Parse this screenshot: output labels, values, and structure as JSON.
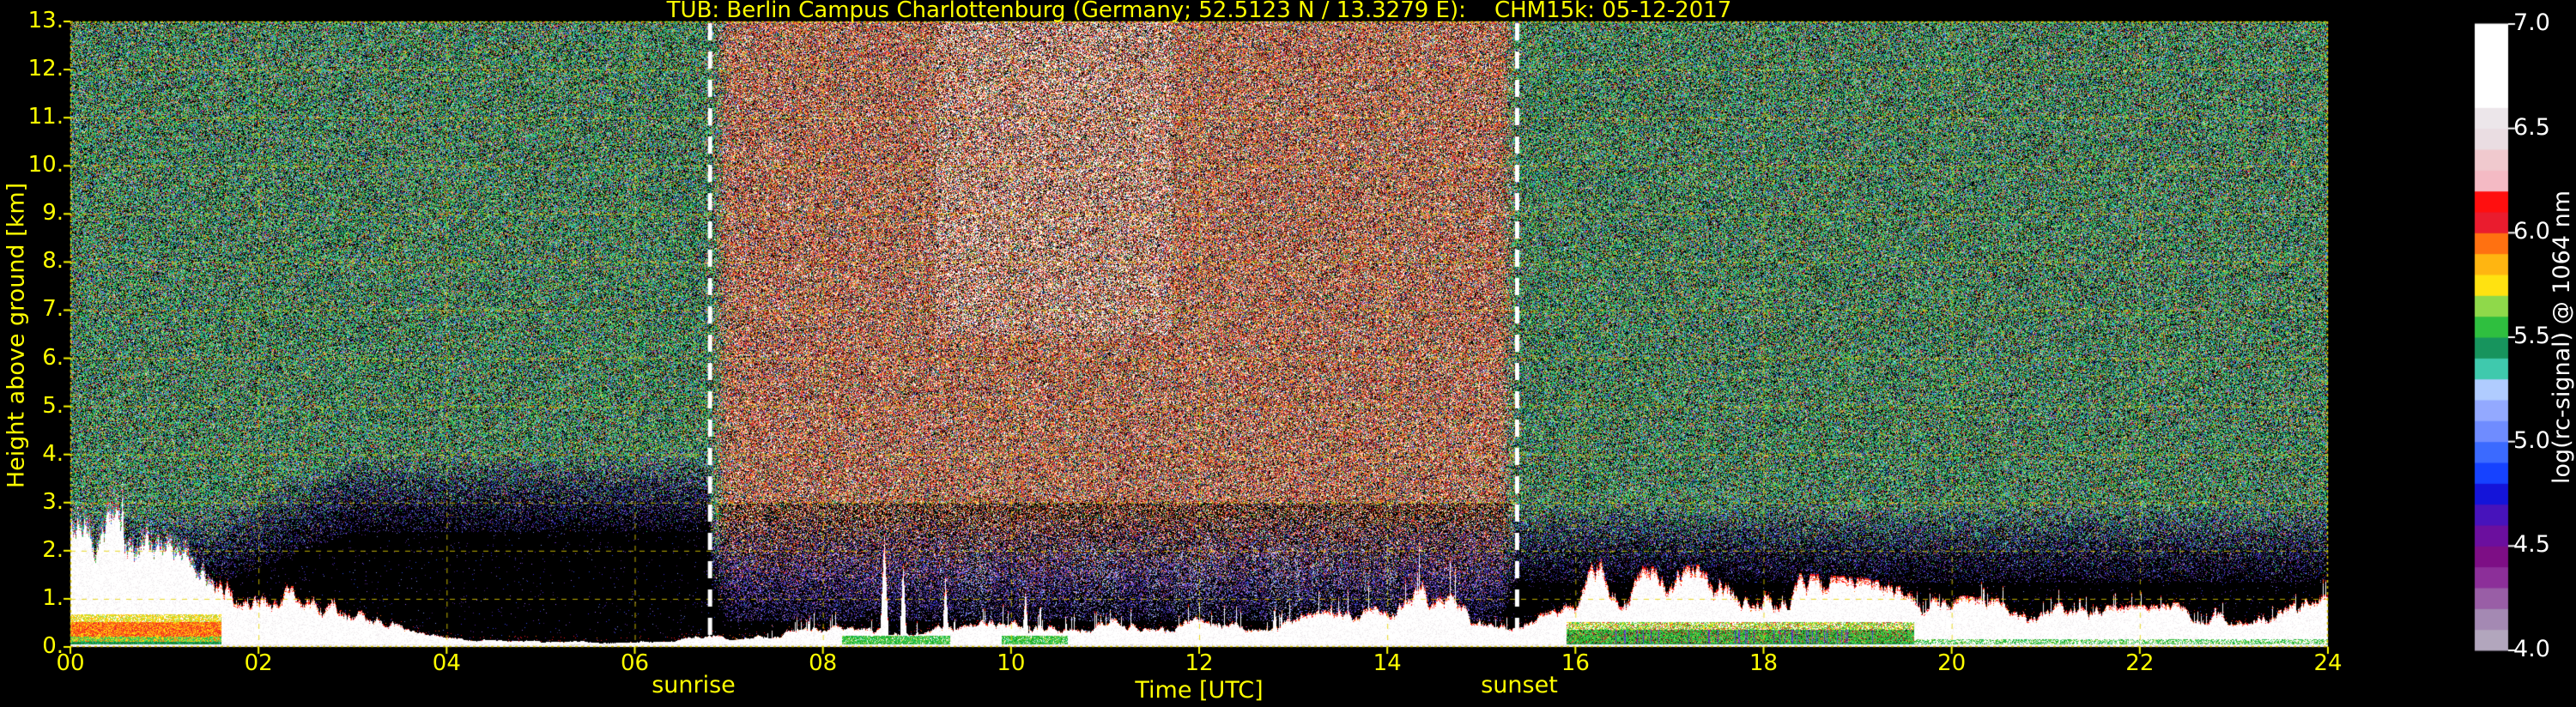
{
  "title": "TUB: Berlin Campus Charlottenburg (Germany; 52.5123 N / 13.3279 E):    CHM15k: 05-12-2017",
  "station": "TUB: Berlin Campus Charlottenburg",
  "country": "Germany",
  "coordinates": "52.5123 N / 13.3279 E",
  "instrument": "CHM15k",
  "date": "05-12-2017",
  "chart_data": {
    "type": "heatmap",
    "title": "TUB: Berlin Campus Charlottenburg (Germany; 52.5123 N / 13.3279 E):    CHM15k: 05-12-2017",
    "xlabel": "Time [UTC]",
    "ylabel": "Height above ground [km]",
    "xlim": [
      0,
      24
    ],
    "ylim": [
      0,
      13
    ],
    "grid": "yellow dashed, 2 h vertical / 1 km horizontal",
    "xticks": {
      "values": [
        0,
        2,
        4,
        6,
        8,
        10,
        12,
        14,
        16,
        18,
        20,
        22,
        24
      ],
      "labels": [
        "00",
        "02",
        "04",
        "06",
        "08",
        "10",
        "12",
        "14",
        "16",
        "18",
        "20",
        "22",
        "24"
      ]
    },
    "yticks": {
      "values": [
        0,
        1,
        2,
        3,
        4,
        5,
        6,
        7,
        8,
        9,
        10,
        11,
        12,
        13
      ],
      "labels": [
        "0.",
        "1.",
        "2.",
        "3.",
        "4.",
        "5.",
        "6.",
        "7.",
        "8.",
        "9.",
        "10.",
        "11.",
        "12.",
        "13."
      ]
    },
    "annotations": {
      "sunrise": {
        "label": "sunrise",
        "time_utc": 6.8
      },
      "sunset": {
        "label": "sunset",
        "time_utc": 15.38
      }
    },
    "colorbar": {
      "label": "log(rc-signal) @ 1064 nm",
      "range": [
        4.0,
        7.0
      ],
      "ticks": {
        "values": [
          4.0,
          4.5,
          5.0,
          5.5,
          6.0,
          6.5,
          7.0
        ],
        "labels": [
          "4.0",
          "4.5",
          "5.0",
          "5.5",
          "6.0",
          "6.5",
          "7.0"
        ]
      },
      "colors_bottom_to_top": [
        "#b2a6bd",
        "#a489b3",
        "#995ea6",
        "#8c2f99",
        "#7d0e85",
        "#6b0f9e",
        "#4713bb",
        "#1414d9",
        "#1642ff",
        "#3b6aff",
        "#6f8cff",
        "#93a9ff",
        "#b0ccff",
        "#3fc9ad",
        "#17945d",
        "#2fbf3f",
        "#8fd94a",
        "#ffe211",
        "#ffb511",
        "#ff7111",
        "#ea1c2e",
        "#ff0f0f",
        "#f4bac4",
        "#f0c9ce",
        "#eadde2",
        "#ece6ea",
        "#ffffff",
        "#ffffff",
        "#ffffff",
        "#ffffff"
      ]
    },
    "signal": {
      "description": "Ceilometer attenuated-backscatter quicklook: strong white/rainbow boundary-layer signal below ~1-3 km, colorful background noise aloft (green/blue at night, red/white during daylight between sunrise and sunset dashed lines).",
      "boundary_layer_top_km": [
        [
          0,
          2.7
        ],
        [
          0.3,
          2.5
        ],
        [
          0.6,
          2.1
        ],
        [
          0.9,
          1.75
        ],
        [
          1.2,
          1.55
        ],
        [
          1.6,
          1.35
        ],
        [
          2.0,
          1.05
        ],
        [
          2.4,
          0.85
        ],
        [
          2.8,
          0.9
        ],
        [
          3.2,
          0.55
        ],
        [
          3.6,
          0.25
        ],
        [
          4.0,
          0.14
        ],
        [
          4.5,
          0.1
        ],
        [
          5.0,
          0.1
        ],
        [
          5.5,
          0.1
        ],
        [
          6.0,
          0.12
        ],
        [
          6.5,
          0.16
        ],
        [
          7.0,
          0.2
        ],
        [
          7.5,
          0.26
        ],
        [
          8.0,
          0.3
        ],
        [
          8.5,
          0.32
        ],
        [
          9.0,
          0.36
        ],
        [
          9.5,
          0.38
        ],
        [
          10,
          0.4
        ],
        [
          10.5,
          0.42
        ],
        [
          11,
          0.42
        ],
        [
          11.5,
          0.44
        ],
        [
          12,
          0.44
        ],
        [
          12.5,
          0.46
        ],
        [
          13,
          0.5
        ],
        [
          13.5,
          0.55
        ],
        [
          14,
          0.6
        ],
        [
          14.35,
          1.0
        ],
        [
          14.7,
          0.75
        ],
        [
          15.1,
          0.6
        ],
        [
          15.38,
          0.45
        ],
        [
          15.7,
          0.5
        ],
        [
          16.0,
          0.7
        ],
        [
          16.2,
          1.3
        ],
        [
          16.5,
          1.15
        ],
        [
          17,
          1.15
        ],
        [
          17.5,
          1.2
        ],
        [
          18,
          1.1
        ],
        [
          18.5,
          1.05
        ],
        [
          19,
          1.0
        ],
        [
          19.5,
          0.9
        ],
        [
          20,
          0.75
        ],
        [
          20.5,
          0.7
        ],
        [
          21,
          0.65
        ],
        [
          21.5,
          0.6
        ],
        [
          22,
          0.6
        ],
        [
          22.5,
          0.65
        ],
        [
          23,
          0.65
        ],
        [
          23.5,
          0.7
        ],
        [
          24,
          0.75
        ]
      ],
      "spikes": [
        [
          0.15,
          3.0,
          0.06
        ],
        [
          0.55,
          3.6,
          0.05
        ],
        [
          8.65,
          2.4,
          0.05
        ],
        [
          8.85,
          1.8,
          0.04
        ],
        [
          9.3,
          1.5,
          0.04
        ],
        [
          10.15,
          1.2,
          0.04
        ],
        [
          12.8,
          0.9,
          0.04
        ],
        [
          13.4,
          0.95,
          0.05
        ],
        [
          14.35,
          1.12,
          0.18
        ],
        [
          16.2,
          1.45,
          0.12
        ],
        [
          19.8,
          1.05,
          0.05
        ],
        [
          20.1,
          1.1,
          0.06
        ],
        [
          21.3,
          0.95,
          0.05
        ],
        [
          22.8,
          0.9,
          0.05
        ]
      ]
    },
    "noise": {
      "night_high": [
        [
          "#2fbf55",
          18
        ],
        [
          "#29c98c",
          12
        ],
        [
          "#63d955",
          8
        ],
        [
          "#15913a",
          8
        ],
        [
          "#3b6ae0",
          11
        ],
        [
          "#52b6ea",
          6
        ],
        [
          "#d6cf2f",
          8
        ],
        [
          "#e08a2f",
          6
        ],
        [
          "#dd3b2f",
          8
        ],
        [
          "#b03bc0",
          4
        ],
        [
          "#e8e8e8",
          4
        ],
        [
          "#227a8a",
          7
        ]
      ],
      "night_low": [
        [
          "#55289c",
          24
        ],
        [
          "#3b2cd8",
          18
        ],
        [
          "#2f4fe8",
          14
        ],
        [
          "#8a5fe0",
          12
        ],
        [
          "#41226b",
          22
        ],
        [
          "#7a8fe8",
          10
        ]
      ],
      "day_high": [
        [
          "#e0342a",
          26
        ],
        [
          "#ef7f2a",
          14
        ],
        [
          "#efcf3a",
          9
        ],
        [
          "#ffffff",
          14
        ],
        [
          "#2faf5f",
          10
        ],
        [
          "#2f5fd8",
          7
        ],
        [
          "#f0b0a8",
          12
        ],
        [
          "#8a2f6a",
          8
        ]
      ],
      "day_low": [
        [
          "#55289c",
          25
        ],
        [
          "#3b2cd8",
          20
        ],
        [
          "#4a6ae8",
          20
        ],
        [
          "#8a5fe0",
          20
        ],
        [
          "#b07ad0",
          15
        ]
      ],
      "streak": [
        [
          "#9fb8ff",
          40
        ],
        [
          "#b8d4ff",
          30
        ],
        [
          "#7f9fff",
          30
        ]
      ]
    },
    "bl_palettes": {
      "ground_green": [
        [
          "#0f7a2f",
          30
        ],
        [
          "#1a9a4f",
          30
        ],
        [
          "#27c98f",
          20
        ],
        [
          "#12862f",
          20
        ]
      ],
      "low_mix_plume": [
        [
          "#2fbf3f",
          25
        ],
        [
          "#8fd94a",
          20
        ],
        [
          "#ffe211",
          25
        ],
        [
          "#27c96f",
          15
        ],
        [
          "#ff7111",
          15
        ]
      ],
      "mid_rainbow": [
        [
          "#ff7111",
          22
        ],
        [
          "#ea1c2e",
          22
        ],
        [
          "#ffb511",
          20
        ],
        [
          "#ffe211",
          18
        ],
        [
          "#ff4511",
          18
        ]
      ],
      "upper_yellow": [
        [
          "#ffe211",
          30
        ],
        [
          "#a5dc47",
          25
        ],
        [
          "#ffb511",
          20
        ],
        [
          "#ffffff",
          25
        ]
      ],
      "evening_green": [
        [
          "#2fbf3f",
          30
        ],
        [
          "#12a51a",
          18
        ],
        [
          "#ea1c2e",
          12
        ],
        [
          "#27c96f",
          14
        ],
        [
          "#111111",
          10
        ],
        [
          "#a5dc47",
          16
        ]
      ],
      "evening_upper": [
        [
          "#2fbf3f",
          22
        ],
        [
          "#a5dc47",
          20
        ],
        [
          "#ffe211",
          18
        ],
        [
          "#ffffff",
          28
        ],
        [
          "#ea1c2e",
          12
        ]
      ],
      "day_green_patch": [
        [
          "#2fbf3f",
          30
        ],
        [
          "#12a51a",
          20
        ],
        [
          "#27c96f",
          18
        ],
        [
          "#ffffff",
          16
        ],
        [
          "#a5dc47",
          16
        ]
      ],
      "cap_red": [
        [
          "#ea1c2e",
          45
        ],
        [
          "#ff0f0f",
          35
        ],
        [
          "#ff7111",
          20
        ]
      ],
      "cap_mix": [
        [
          "#ff0f0f",
          40
        ],
        [
          "#ff7111",
          30
        ],
        [
          "#f4bac4",
          30
        ]
      ],
      "plume_cap": [
        [
          "#3b6ae0",
          30
        ],
        [
          "#2fbf3f",
          25
        ],
        [
          "#ea1c2e",
          25
        ],
        [
          "#ffffff",
          20
        ]
      ],
      "evening_tint": [
        [
          "#5a2fa0",
          40
        ],
        [
          "#3b2cd8",
          30
        ],
        [
          "#8a5fe0",
          30
        ]
      ]
    },
    "colors": {
      "background": "#000000",
      "axis_text": "#ffff00",
      "grid": "#e6d200",
      "colorbar_text": "#ffffff",
      "sun_lines": "#ffffff"
    }
  }
}
